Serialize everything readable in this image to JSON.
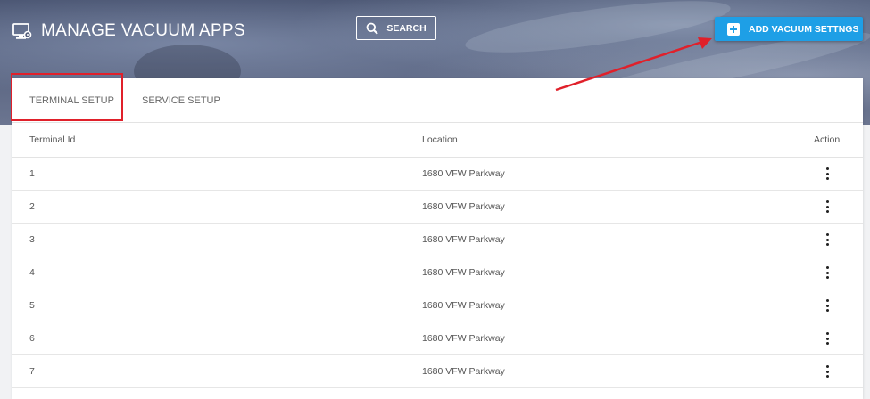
{
  "header": {
    "title": "MANAGE VACUUM APPS",
    "search_label": "SEARCH",
    "add_label": "ADD VACUUM SETTNGS"
  },
  "tabs": [
    {
      "label": "TERMINAL SETUP",
      "active": true
    },
    {
      "label": "SERVICE SETUP",
      "active": false
    }
  ],
  "table": {
    "columns": [
      "Terminal Id",
      "Location",
      "Action"
    ],
    "rows": [
      {
        "id": "1",
        "location": "1680 VFW Parkway"
      },
      {
        "id": "2",
        "location": "1680 VFW Parkway"
      },
      {
        "id": "3",
        "location": "1680 VFW Parkway"
      },
      {
        "id": "4",
        "location": "1680 VFW Parkway"
      },
      {
        "id": "5",
        "location": "1680 VFW Parkway"
      },
      {
        "id": "6",
        "location": "1680 VFW Parkway"
      },
      {
        "id": "7",
        "location": "1680 VFW Parkway"
      }
    ]
  },
  "icons": {
    "title": "monitor-settings-icon",
    "search": "search-icon",
    "add": "plus-box-icon",
    "action": "more-vertical-icon"
  },
  "colors": {
    "accent": "#1e9fe6",
    "annotation": "#e0202a"
  }
}
